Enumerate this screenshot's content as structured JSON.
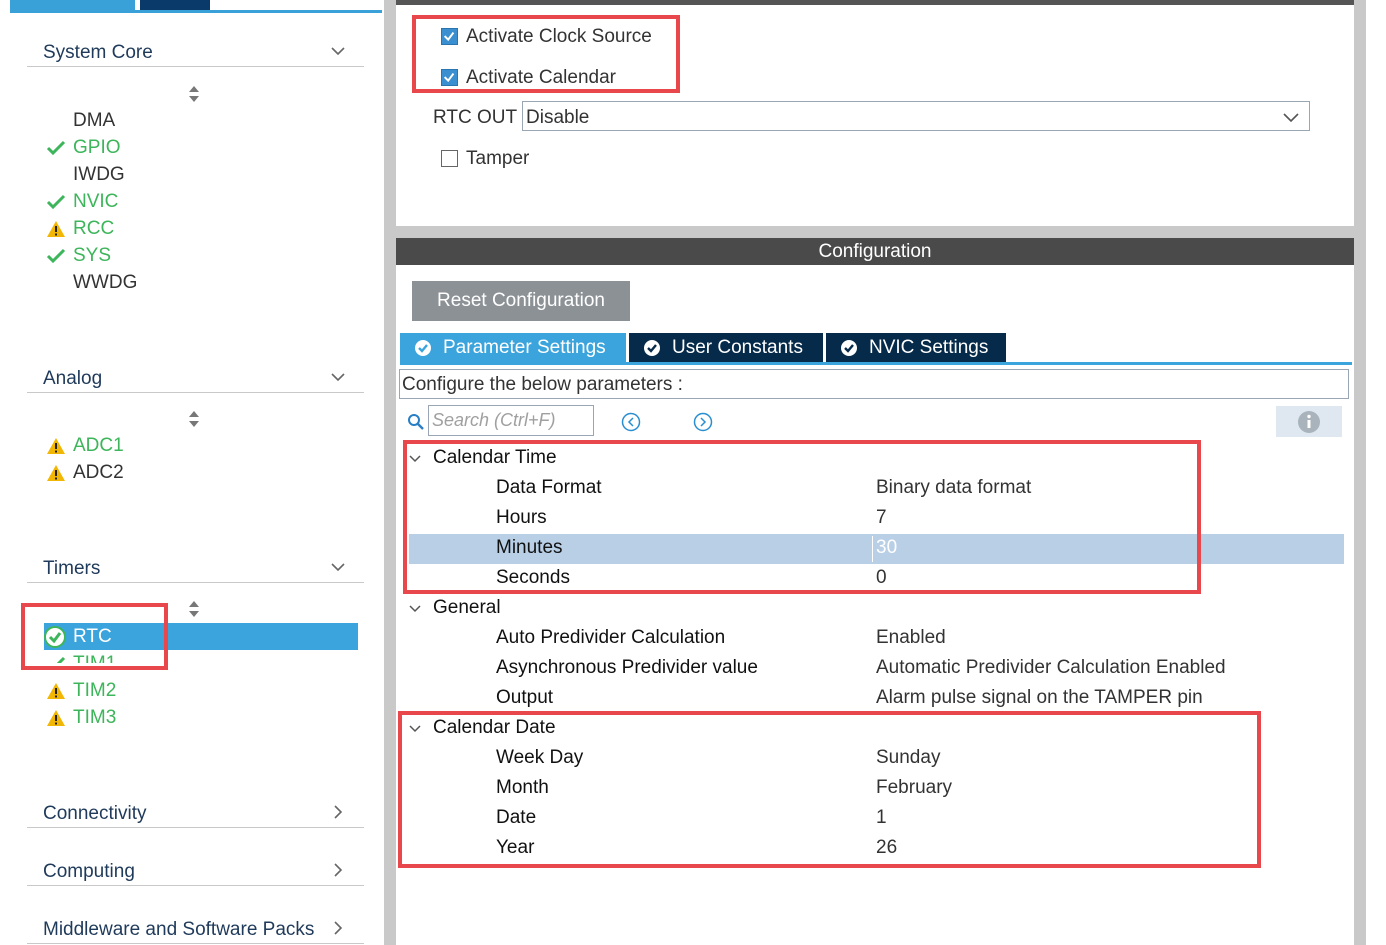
{
  "left": {
    "categories": [
      {
        "label": "System Core",
        "chevron": "down",
        "items": [
          {
            "label": "DMA",
            "status": "none"
          },
          {
            "label": "GPIO",
            "status": "ok"
          },
          {
            "label": "IWDG",
            "status": "none"
          },
          {
            "label": "NVIC",
            "status": "ok"
          },
          {
            "label": "RCC",
            "status": "warn"
          },
          {
            "label": "SYS",
            "status": "ok"
          },
          {
            "label": "WWDG",
            "status": "none"
          }
        ]
      },
      {
        "label": "Analog",
        "chevron": "down",
        "items": [
          {
            "label": "ADC1",
            "status": "warn"
          },
          {
            "label": "ADC2",
            "status": "warn"
          }
        ]
      },
      {
        "label": "Timers",
        "chevron": "down",
        "items": [
          {
            "label": "RTC",
            "status": "ok",
            "selected": true
          },
          {
            "label": "TIM1",
            "status": "ok"
          },
          {
            "label": "TIM2",
            "status": "warn"
          },
          {
            "label": "TIM3",
            "status": "warn"
          }
        ]
      },
      {
        "label": "Connectivity",
        "chevron": "right"
      },
      {
        "label": "Computing",
        "chevron": "right"
      },
      {
        "label": "Middleware and Software Packs",
        "chevron": "right"
      }
    ]
  },
  "mode": {
    "activate_clock_source": {
      "label": "Activate Clock Source",
      "checked": true
    },
    "activate_calendar": {
      "label": "Activate Calendar",
      "checked": true
    },
    "rtc_out_label": "RTC OUT",
    "rtc_out_value": "Disable",
    "tamper": {
      "label": "Tamper",
      "checked": false
    }
  },
  "config": {
    "header": "Configuration",
    "reset_button": "Reset Configuration",
    "tabs": [
      {
        "label": "Parameter Settings",
        "active": true
      },
      {
        "label": "User Constants",
        "active": false
      },
      {
        "label": "NVIC Settings",
        "active": false
      }
    ],
    "hint": "Configure the below parameters :",
    "search_placeholder": "Search (Ctrl+F)",
    "groups": [
      {
        "label": "Calendar Time",
        "params": [
          {
            "name": "Data Format",
            "value": "Binary data format"
          },
          {
            "name": "Hours",
            "value": "7"
          },
          {
            "name": "Minutes",
            "value": "30",
            "selected": true
          },
          {
            "name": "Seconds",
            "value": "0"
          }
        ]
      },
      {
        "label": "General",
        "params": [
          {
            "name": "Auto Predivider Calculation",
            "value": "Enabled"
          },
          {
            "name": "Asynchronous Predivider value",
            "value": "Automatic Predivider Calculation Enabled"
          },
          {
            "name": "Output",
            "value": "Alarm pulse signal on the TAMPER pin"
          }
        ]
      },
      {
        "label": "Calendar Date",
        "params": [
          {
            "name": "Week Day",
            "value": "Sunday"
          },
          {
            "name": "Month",
            "value": "February"
          },
          {
            "name": "Date",
            "value": "1"
          },
          {
            "name": "Year",
            "value": "26"
          }
        ]
      }
    ]
  },
  "colors": {
    "accent": "#3ba4dc",
    "ok": "#3db55a",
    "warn": "#f2b705",
    "highlight": "#e8474c",
    "selected_row": "#b9cfe6"
  }
}
